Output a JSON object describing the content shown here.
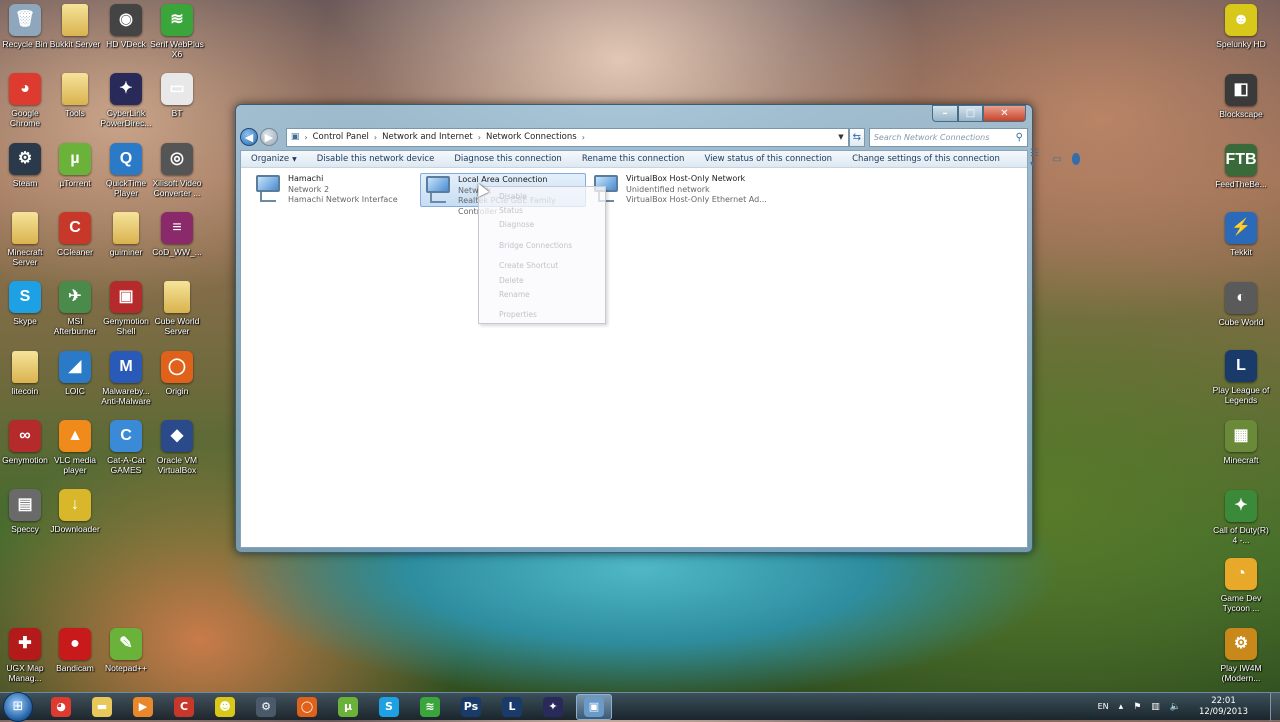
{
  "desktop_icons": [
    {
      "label": "Recycle Bin",
      "glyph": "🗑",
      "color": "#8ea7bd"
    },
    {
      "label": "Bukkit Server",
      "glyph": "",
      "color": "folder"
    },
    {
      "label": "HD VDeck",
      "glyph": "◉",
      "color": "#444444"
    },
    {
      "label": "Serif WebPlus X6",
      "glyph": "≋",
      "color": "#3aa53a"
    },
    {
      "label": "Google Chrome",
      "glyph": "◕",
      "color": "#dd3b2f"
    },
    {
      "label": "Tools",
      "glyph": "",
      "color": "folder"
    },
    {
      "label": "CyberLink PowerDirec...",
      "glyph": "✦",
      "color": "#2a2a5a"
    },
    {
      "label": "BT",
      "glyph": "▭",
      "color": "#e8e8e8"
    },
    {
      "label": "Steam",
      "glyph": "⚙",
      "color": "#2a3a4a"
    },
    {
      "label": "µTorrent",
      "glyph": "µ",
      "color": "#6ab23a"
    },
    {
      "label": "QuickTime Player",
      "glyph": "Q",
      "color": "#2a7ac8"
    },
    {
      "label": "Xilisoft Video Converter ...",
      "glyph": "◎",
      "color": "#555555"
    },
    {
      "label": "Minecraft Server",
      "glyph": "",
      "color": "folder"
    },
    {
      "label": "CCleaner",
      "glyph": "C",
      "color": "#c8382a"
    },
    {
      "label": "guiminer",
      "glyph": "",
      "color": "folder"
    },
    {
      "label": "CoD_WW_...",
      "glyph": "≡",
      "color": "#8a2a6a"
    },
    {
      "label": "Skype",
      "glyph": "S",
      "color": "#1da1e4"
    },
    {
      "label": "MSI Afterburner",
      "glyph": "✈",
      "color": "#4a8a4a"
    },
    {
      "label": "Genymotion Shell",
      "glyph": "▣",
      "color": "#b52a2a"
    },
    {
      "label": "Cube World Server",
      "glyph": "",
      "color": "folder"
    },
    {
      "label": "litecoin",
      "glyph": "",
      "color": "folder"
    },
    {
      "label": "LOIC",
      "glyph": "◢",
      "color": "#2a7ac8"
    },
    {
      "label": "Malwareby... Anti-Malware",
      "glyph": "M",
      "color": "#2a5ab8"
    },
    {
      "label": "Origin",
      "glyph": "◯",
      "color": "#e0611a"
    },
    {
      "label": "Genymotion",
      "glyph": "∞",
      "color": "#b52a2a"
    },
    {
      "label": "VLC media player",
      "glyph": "▲",
      "color": "#f08a1a"
    },
    {
      "label": "Cat-A-Cat GAMES",
      "glyph": "C",
      "color": "#3a8ad8"
    },
    {
      "label": "Oracle VM VirtualBox",
      "glyph": "◆",
      "color": "#2a4a8a"
    },
    {
      "label": "Speccy",
      "glyph": "▤",
      "color": "#6a6a6a"
    },
    {
      "label": "JDownloader",
      "glyph": "↓",
      "color": "#d8b82a"
    },
    {
      "label": "UGX Map Manag...",
      "glyph": "✚",
      "color": "#b51a1a"
    },
    {
      "label": "Bandicam",
      "glyph": "●",
      "color": "#c81a1a"
    },
    {
      "label": "Notepad++",
      "glyph": "✎",
      "color": "#6ab23a"
    }
  ],
  "right_icons": [
    {
      "label": "Spelunky HD",
      "glyph": "☻",
      "color": "#d8c81a"
    },
    {
      "label": "Blockscape",
      "glyph": "◧",
      "color": "#3a3a3a"
    },
    {
      "label": "FeedTheBe...",
      "glyph": "FTB",
      "color": "#3a6a3a"
    },
    {
      "label": "Tekkit",
      "glyph": "⚡",
      "color": "#2a6ab8"
    },
    {
      "label": "Cube World",
      "glyph": "◐",
      "color": "#5a5a5a"
    },
    {
      "label": "Play League of Legends",
      "glyph": "L",
      "color": "#1a3a6a"
    },
    {
      "label": "Minecraft",
      "glyph": "▦",
      "color": "#6a8a3a"
    },
    {
      "label": "Call of Duty(R) 4 -...",
      "glyph": "✦",
      "color": "#3a8a3a"
    },
    {
      "label": "Game Dev Tycoon ...",
      "glyph": "◔",
      "color": "#e8a82a"
    },
    {
      "label": "Play IW4M (Modern...",
      "glyph": "⚙",
      "color": "#c8881a"
    }
  ],
  "window": {
    "breadcrumb": [
      "Control Panel",
      "Network and Internet",
      "Network Connections"
    ],
    "search_placeholder": "Search Network Connections",
    "toolbar": [
      "Organize",
      "Disable this network device",
      "Diagnose this connection",
      "Rename this connection",
      "View status of this connection",
      "Change settings of this connection"
    ],
    "connections": [
      {
        "name": "Hamachi",
        "status": "Network 2",
        "device": "Hamachi Network Interface"
      },
      {
        "name": "Local Area Connection",
        "status": "Network",
        "device": "Realtek PCIe GBE Family Controller"
      },
      {
        "name": "VirtualBox Host-Only Network",
        "status": "Unidentified network",
        "device": "VirtualBox Host-Only Ethernet Ad..."
      }
    ],
    "context_menu": [
      "Disable",
      "Status",
      "Diagnose",
      "Bridge Connections",
      "Create Shortcut",
      "Delete",
      "Rename",
      "Properties"
    ]
  },
  "taskbar": {
    "apps": [
      {
        "name": "chrome",
        "glyph": "◕",
        "color": "#dd3b2f"
      },
      {
        "name": "explorer",
        "glyph": "▬",
        "color": "#e8c85a"
      },
      {
        "name": "media-player",
        "glyph": "▶",
        "color": "#e8882a"
      },
      {
        "name": "ccleaner",
        "glyph": "C",
        "color": "#c8382a"
      },
      {
        "name": "spelunky",
        "glyph": "☻",
        "color": "#d8c81a"
      },
      {
        "name": "steam",
        "glyph": "⚙",
        "color": "#4a5a6a"
      },
      {
        "name": "origin",
        "glyph": "◯",
        "color": "#e0611a"
      },
      {
        "name": "utorrent",
        "glyph": "µ",
        "color": "#6ab23a"
      },
      {
        "name": "skype",
        "glyph": "S",
        "color": "#1da1e4"
      },
      {
        "name": "webplus",
        "glyph": "≋",
        "color": "#3aa53a"
      },
      {
        "name": "photoshop",
        "glyph": "Ps",
        "color": "#1a3a6a"
      },
      {
        "name": "league",
        "glyph": "L",
        "color": "#1a3a6a"
      },
      {
        "name": "cyberlink",
        "glyph": "✦",
        "color": "#2a2a5a"
      },
      {
        "name": "network-connections",
        "glyph": "▣",
        "color": "#6a9ac8"
      }
    ],
    "language": "EN",
    "time": "22:01",
    "date": "12/09/2013"
  }
}
